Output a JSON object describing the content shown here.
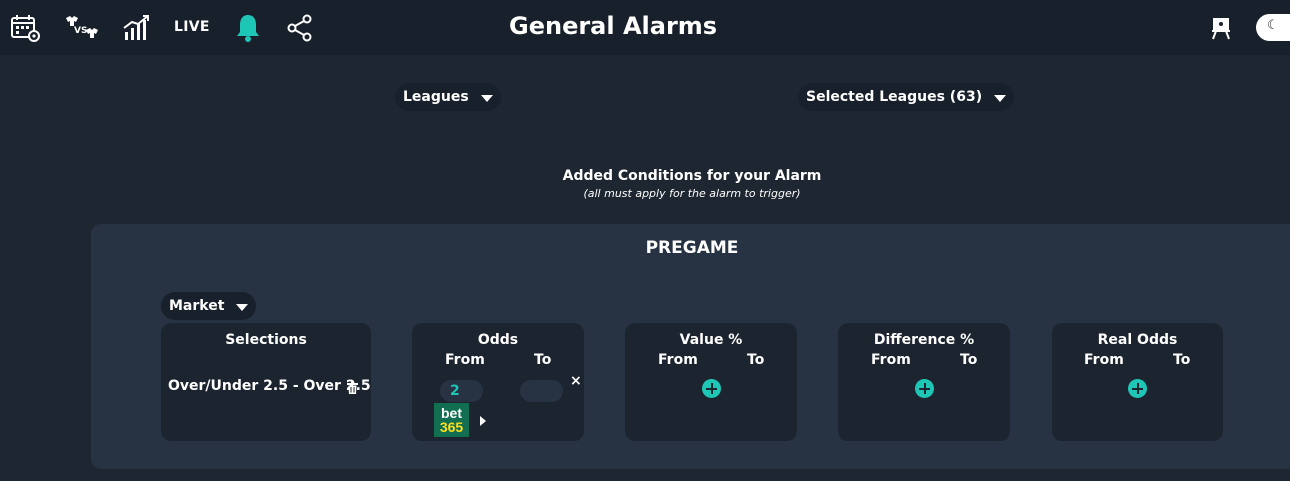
{
  "header": {
    "title": "General Alarms",
    "live_label": "LIVE",
    "icons": [
      "calendar-gear-icon",
      "versus-icon",
      "stats-chart-icon",
      "bell-icon",
      "share-icon",
      "easel-icon",
      "moon-icon"
    ],
    "accent_color": "#1ec6b6"
  },
  "filters": {
    "leagues_label": "Leagues",
    "selected_leagues_label": "Selected Leagues (63)"
  },
  "conditions": {
    "title": "Added Conditions for your Alarm",
    "subtitle": "(all must apply for the alarm to trigger)"
  },
  "pregame": {
    "title": "PREGAME",
    "market_label": "Market",
    "selections": {
      "title": "Selections",
      "value": "Over/Under 2.5 - Over 2.5"
    },
    "odds": {
      "title": "Odds",
      "from_label": "From",
      "to_label": "To",
      "from_value": "2",
      "to_value": "",
      "close_glyph": "×",
      "bookmaker_top": "bet",
      "bookmaker_bottom": "365"
    },
    "value_pct": {
      "title": "Value %",
      "from_label": "From",
      "to_label": "To"
    },
    "difference_pct": {
      "title": "Difference %",
      "from_label": "From",
      "to_label": "To"
    },
    "real_odds": {
      "title": "Real Odds",
      "from_label": "From",
      "to_label": "To"
    }
  }
}
